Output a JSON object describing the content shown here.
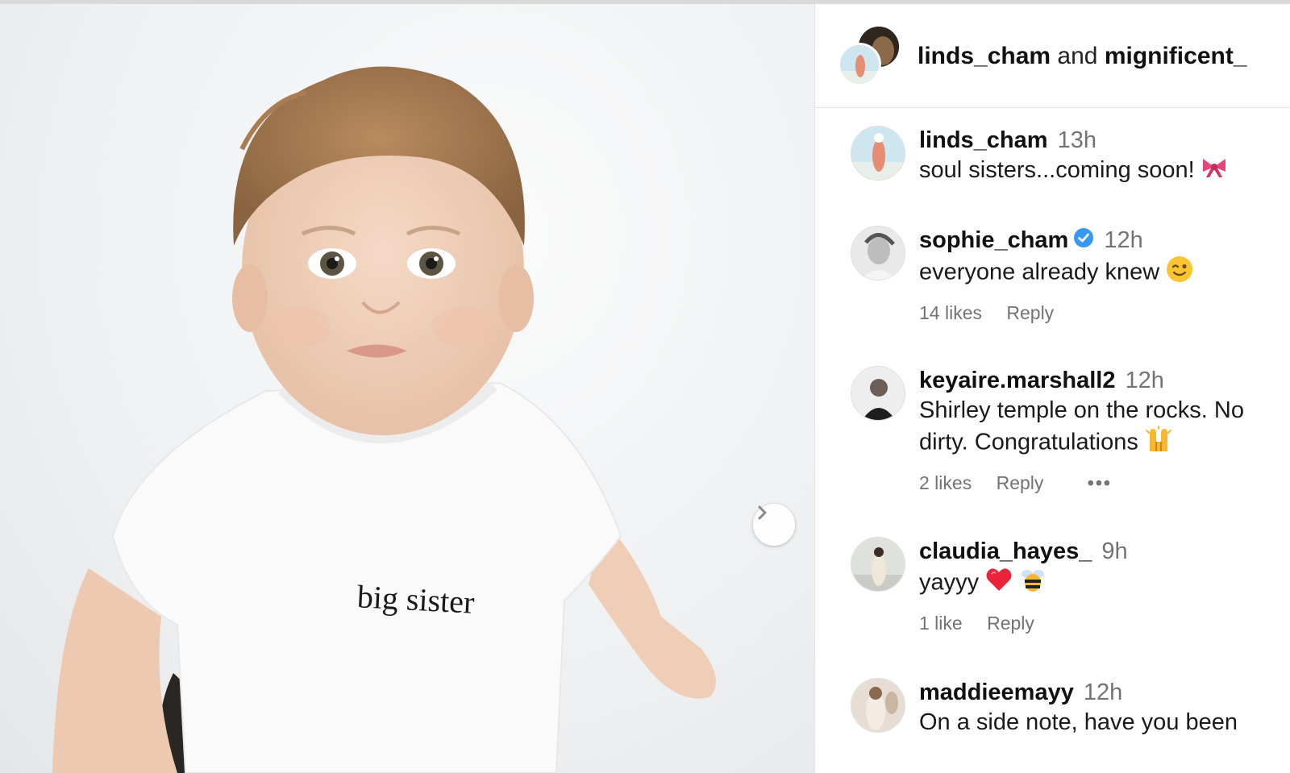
{
  "media": {
    "shirt_text": "big sister",
    "next_icon": "chevron-right-icon"
  },
  "header": {
    "user1": "linds_cham",
    "joiner": "and",
    "user2": "mignificent_"
  },
  "comments": [
    {
      "username": "linds_cham",
      "time": "13h",
      "text": "soul sisters...coming soon!",
      "emoji": [
        "ribbon-icon"
      ],
      "likes": "",
      "reply": "",
      "verified": false
    },
    {
      "username": "sophie_cham",
      "time": "12h",
      "text": "everyone already knew",
      "emoji": [
        "winking-face-icon"
      ],
      "likes": "14 likes",
      "reply": "Reply",
      "verified": true
    },
    {
      "username": "keyaire.marshall2",
      "time": "12h",
      "text": "Shirley temple on the rocks. No dirty. Congratulations",
      "emoji": [
        "raising-hands-icon"
      ],
      "likes": "2 likes",
      "reply": "Reply",
      "verified": false,
      "more": "•••"
    },
    {
      "username": "claudia_hayes_",
      "time": "9h",
      "text": "yayyy",
      "emoji": [
        "heart-icon",
        "bee-icon"
      ],
      "likes": "1 like",
      "reply": "Reply",
      "verified": false
    },
    {
      "username": "maddieemayy",
      "time": "12h",
      "text": "On a side note, have you been",
      "emoji": [],
      "likes": "",
      "reply": "",
      "verified": false
    }
  ],
  "colors": {
    "verified": "#3897f0",
    "muted": "#737373",
    "divider": "#e3e3e3"
  }
}
